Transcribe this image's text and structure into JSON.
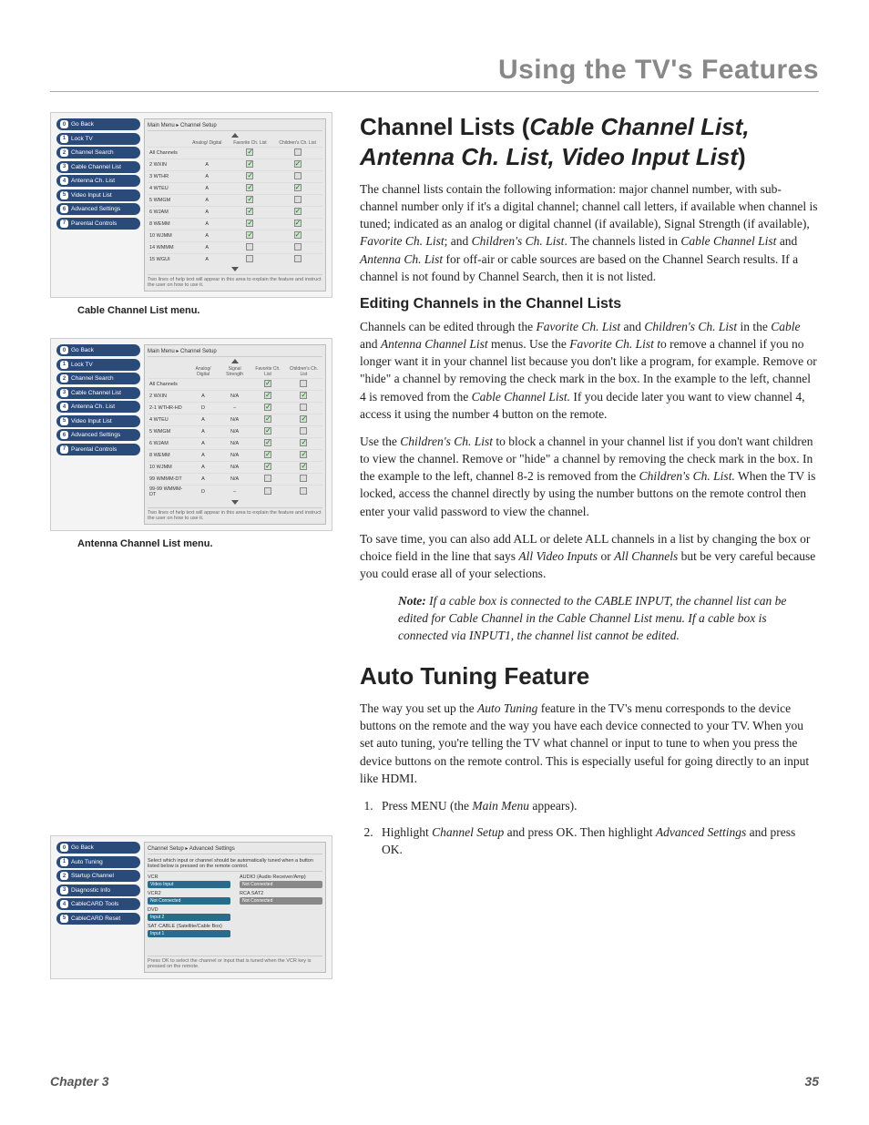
{
  "header": "Using the TV's Features",
  "footer": {
    "chapter": "Chapter 3",
    "page": "35"
  },
  "captions": {
    "cable": "Cable Channel List menu.",
    "antenna": "Antenna Channel List menu."
  },
  "menu1": {
    "breadcrumb": "Main Menu ▸ Channel Setup",
    "sidebar": [
      {
        "n": "0",
        "l": "Go Back"
      },
      {
        "n": "1",
        "l": "Lock TV"
      },
      {
        "n": "2",
        "l": "Channel Search"
      },
      {
        "n": "3",
        "l": "Cable Channel List"
      },
      {
        "n": "4",
        "l": "Antenna Ch. List"
      },
      {
        "n": "5",
        "l": "Video Input List"
      },
      {
        "n": "6",
        "l": "Advanced Settings"
      },
      {
        "n": "7",
        "l": "Parental Controls"
      }
    ],
    "headers": {
      "c1": "",
      "c2": "Analog/ Digital",
      "c3": "Favorite Ch. List",
      "c4": "Children's Ch. List"
    },
    "rows": [
      {
        "ch": "All Channels",
        "ad": "",
        "fav": "on",
        "kid": "off"
      },
      {
        "ch": "2 WXIN",
        "ad": "A",
        "fav": "on",
        "kid": "on"
      },
      {
        "ch": "3 WTHR",
        "ad": "A",
        "fav": "on",
        "kid": "off"
      },
      {
        "ch": "4 WTEU",
        "ad": "A",
        "fav": "on",
        "kid": "on"
      },
      {
        "ch": "5 WMGM",
        "ad": "A",
        "fav": "on",
        "kid": "off"
      },
      {
        "ch": "6 WJAM",
        "ad": "A",
        "fav": "on",
        "kid": "on"
      },
      {
        "ch": "8 WEMM",
        "ad": "A",
        "fav": "on",
        "kid": "on"
      },
      {
        "ch": "10 WJMM",
        "ad": "A",
        "fav": "on",
        "kid": "on"
      },
      {
        "ch": "14 WMMM",
        "ad": "A",
        "fav": "off",
        "kid": "off"
      },
      {
        "ch": "15 WGUI",
        "ad": "A",
        "fav": "off",
        "kid": "off"
      }
    ],
    "help": "Two lines of help text will appear in this area to explain the feature and instruct the user on how to use it."
  },
  "menu2": {
    "breadcrumb": "Main Menu ▸ Channel Setup",
    "sidebar": [
      {
        "n": "0",
        "l": "Go Back"
      },
      {
        "n": "1",
        "l": "Lock TV"
      },
      {
        "n": "2",
        "l": "Channel Search"
      },
      {
        "n": "3",
        "l": "Cable Channel List"
      },
      {
        "n": "4",
        "l": "Antenna Ch. List"
      },
      {
        "n": "5",
        "l": "Video Input List"
      },
      {
        "n": "6",
        "l": "Advanced Settings"
      },
      {
        "n": "7",
        "l": "Parental Controls"
      }
    ],
    "headers": {
      "c1": "",
      "c2": "Analog/ Digital",
      "c3": "Signal Strength",
      "c4": "Favorite Ch. List",
      "c5": "Children's Ch. List"
    },
    "rows": [
      {
        "ch": "All Channels",
        "ad": "",
        "ss": "",
        "fav": "on",
        "kid": "off"
      },
      {
        "ch": "2 WXIN",
        "ad": "A",
        "ss": "N/A",
        "fav": "on",
        "kid": "on"
      },
      {
        "ch": "2-1 WTHR-HD",
        "ad": "D",
        "ss": "–",
        "fav": "on",
        "kid": "off"
      },
      {
        "ch": "4 WTEU",
        "ad": "A",
        "ss": "N/A",
        "fav": "on",
        "kid": "on"
      },
      {
        "ch": "5 WMGM",
        "ad": "A",
        "ss": "N/A",
        "fav": "on",
        "kid": "off"
      },
      {
        "ch": "6 WJAM",
        "ad": "A",
        "ss": "N/A",
        "fav": "on",
        "kid": "on"
      },
      {
        "ch": "8 WEMM",
        "ad": "A",
        "ss": "N/A",
        "fav": "on",
        "kid": "on"
      },
      {
        "ch": "10 WJMM",
        "ad": "A",
        "ss": "N/A",
        "fav": "on",
        "kid": "on"
      },
      {
        "ch": "99 WMMM-DT",
        "ad": "A",
        "ss": "N/A",
        "fav": "off",
        "kid": "off"
      },
      {
        "ch": "99-99 WMMM-DT",
        "ad": "D",
        "ss": "–",
        "fav": "off",
        "kid": "off"
      }
    ],
    "help": "Two lines of help text will appear in this area to explain the feature and instruct the user on how to use it."
  },
  "menu3": {
    "breadcrumb": "Channel Setup ▸ Advanced Settings",
    "sidebar": [
      {
        "n": "0",
        "l": "Go Back"
      },
      {
        "n": "1",
        "l": "Auto Tuning"
      },
      {
        "n": "2",
        "l": "Startup Channel"
      },
      {
        "n": "3",
        "l": "Diagnostic Info"
      },
      {
        "n": "4",
        "l": "CableCARD Tools"
      },
      {
        "n": "5",
        "l": "CableCARD Reset"
      }
    ],
    "intro": "Select which input or channel should be automatically tuned when a button listed below is pressed on the remote control.",
    "rows": [
      {
        "l": "VCR",
        "v": "Video Input",
        "r": "AUDIO (Audio Receiver/Amp)",
        "rv": "Not Connected"
      },
      {
        "l": "VCR2",
        "v": "Not Connected",
        "r": "RCA SAT2",
        "rv": "Not Connected"
      },
      {
        "l": "DVD",
        "v": "Input 2",
        "r": "",
        "rv": ""
      },
      {
        "l": "SAT·CABLE (Satellite/Cable Box)",
        "v": "Input 1",
        "r": "",
        "rv": ""
      }
    ],
    "help": "Press OK to select the channel or input that is tuned when the VCR key is pressed on the remote."
  },
  "section1": {
    "title_a": "Channel Lists (",
    "title_b": "Cable Channel List, Antenna Ch. List, Video Input List",
    "title_c": ")",
    "p1_a": "The channel lists contain the following information: major channel number, with sub-channel number only if it's a digital channel; channel call letters, if available when channel is tuned; indicated as an analog or digital channel (if available), Signal Strength (if available), ",
    "p1_b": "Favorite Ch. List",
    "p1_c": "; and ",
    "p1_d": "Children's Ch. List",
    "p1_e": ". The channels listed in ",
    "p1_f": "Cable Channel List",
    "p1_g": " and ",
    "p1_h": "Antenna Ch. List",
    "p1_i": " for off-air or cable sources are based on the Channel Search results. If a channel is not found by Channel Search, then it is not listed."
  },
  "sub1": {
    "title": "Editing Channels in the Channel Lists",
    "p1_a": "Channels can be edited through the ",
    "p1_b": "Favorite Ch. List",
    "p1_c": " and ",
    "p1_d": "Children's Ch. List",
    "p1_e": " in the ",
    "p1_f": "Cable",
    "p1_g": " and ",
    "p1_h": "Antenna Channel List",
    "p1_i": " menus. Use the ",
    "p1_j": "Favorite Ch. List t",
    "p1_k": "o remove a channel if you no longer want it in your channel list because you don't like a program, for example. Remove or \"hide\" a channel by removing the check mark in the box. In the example to the left, channel 4 is removed from the ",
    "p1_l": "Cable Channel List.",
    "p1_m": " If you decide later you want to view channel 4, access it using the number 4 button on the remote.",
    "p2_a": "Use the ",
    "p2_b": "Children's Ch. List",
    "p2_c": " to block a channel in your channel list if you don't want children to view the channel. Remove or \"hide\" a channel by removing the check mark in the box. In the example to the left, channel 8-2 is removed from the ",
    "p2_d": "Children's Ch. List.",
    "p2_e": " When the TV is locked, access the channel directly by using the number buttons on the remote control then enter your valid password to view the channel.",
    "p3_a": "To save time, you can also add ALL or delete ALL channels in a list by changing the box or choice field in the line that says ",
    "p3_b": "All Video Inputs",
    "p3_c": " or ",
    "p3_d": "All Channels",
    "p3_e": " but be very careful because you could erase all of your selections.",
    "note_a": "Note:",
    "note_b": " If a cable box is connected to the CABLE INPUT, the channel list can be edited for Cable Channel in the Cable Channel List menu. If a cable box is connected via INPUT1, the channel list cannot be edited."
  },
  "section2": {
    "title": "Auto Tuning Feature",
    "p1_a": "The way you set up the ",
    "p1_b": "Auto Tuning",
    "p1_c": " feature in the TV's menu corresponds to the device buttons on the remote and the way you have each device connected to your TV. When you set auto tuning, you're telling the TV what channel or input to tune to when you press the device buttons on the remote control. This is especially useful for going directly to an input like HDMI.",
    "step1_a": "Press MENU (the ",
    "step1_b": "Main Menu",
    "step1_c": " appears).",
    "step2_a": "Highlight ",
    "step2_b": "Channel Setup",
    "step2_c": " and press OK. Then highlight ",
    "step2_d": "Advanced Settings",
    "step2_e": " and press OK."
  }
}
